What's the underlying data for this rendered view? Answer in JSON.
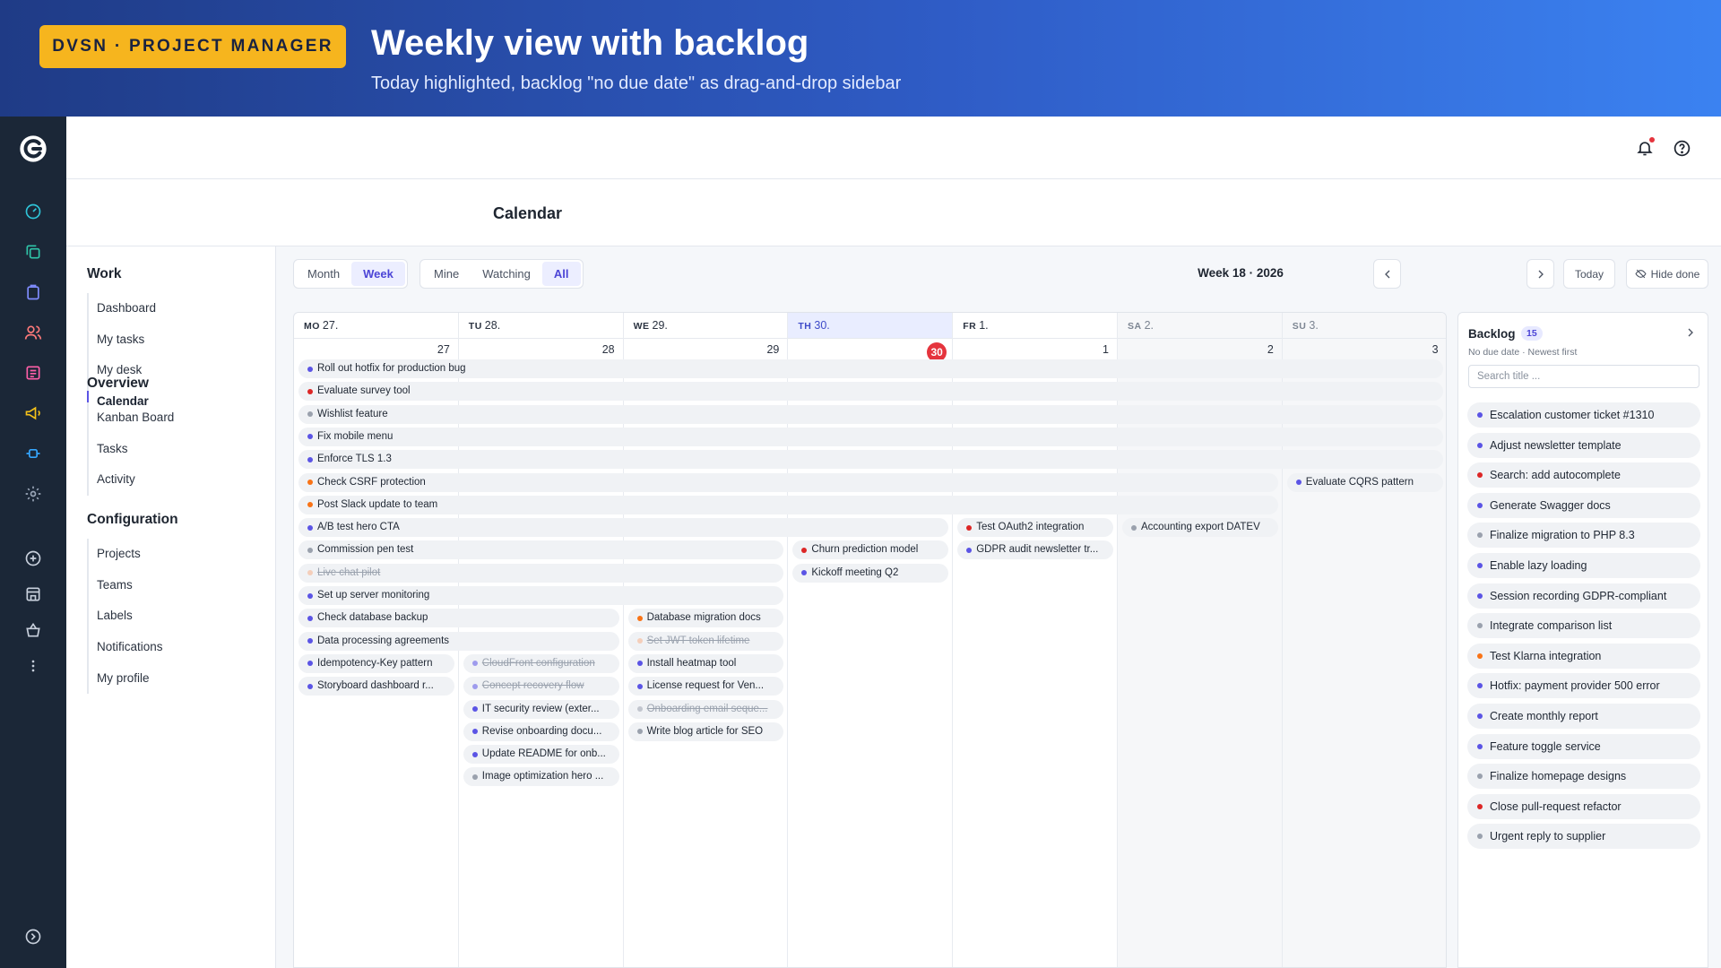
{
  "banner": {
    "badge": "DVSN · PROJECT MANAGER",
    "title": "Weekly view with backlog",
    "subtitle": "Today highlighted, backlog \"no due date\" as drag-and-drop sidebar"
  },
  "header": {
    "title": "Calendar"
  },
  "nav": {
    "sections": [
      {
        "title": "Work",
        "items": [
          "Dashboard",
          "My tasks",
          "My desk",
          "Calendar"
        ]
      },
      {
        "title": "Overview",
        "items": [
          "Kanban Board",
          "Tasks",
          "Activity"
        ]
      },
      {
        "title": "Configuration",
        "items": [
          "Projects",
          "Teams",
          "Labels",
          "Notifications",
          "My profile"
        ]
      }
    ],
    "active": "Calendar"
  },
  "toolbar": {
    "view": [
      "Month",
      "Week"
    ],
    "view_active": "Week",
    "filter": [
      "Mine",
      "Watching",
      "All"
    ],
    "filter_active": "All",
    "week_label": "Week 18 · 2026",
    "today_label": "Today",
    "hide_done_label": "Hide done"
  },
  "colors": {
    "blue": "#5b54e5",
    "red": "#dc2626",
    "gray": "#9aa1ad",
    "orange": "#f97316",
    "peach": "#f7b089",
    "today": "#e5343d",
    "accent": "#4c45d6"
  },
  "calendar": {
    "days": [
      {
        "dow": "MO",
        "label": "27.",
        "num": "27"
      },
      {
        "dow": "TU",
        "label": "28.",
        "num": "28"
      },
      {
        "dow": "WE",
        "label": "29.",
        "num": "29"
      },
      {
        "dow": "TH",
        "label": "30.",
        "num": "30",
        "today": true
      },
      {
        "dow": "FR",
        "label": "1.",
        "num": "1"
      },
      {
        "dow": "SA",
        "label": "2.",
        "num": "2",
        "weekend": true
      },
      {
        "dow": "SU",
        "label": "3.",
        "num": "3",
        "weekend": true
      }
    ],
    "events": [
      {
        "title": "Roll out hotfix for production bug",
        "start": 0,
        "span": 7,
        "row": 0,
        "color": "blue"
      },
      {
        "title": "Evaluate survey tool",
        "start": 0,
        "span": 7,
        "row": 1,
        "color": "red"
      },
      {
        "title": "Wishlist feature",
        "start": 0,
        "span": 7,
        "row": 2,
        "color": "gray"
      },
      {
        "title": "Fix mobile menu",
        "start": 0,
        "span": 7,
        "row": 3,
        "color": "blue"
      },
      {
        "title": "Enforce TLS 1.3",
        "start": 0,
        "span": 7,
        "row": 4,
        "color": "blue"
      },
      {
        "title": "Check CSRF protection",
        "start": 0,
        "span": 6,
        "row": 5,
        "color": "orange"
      },
      {
        "title": "Evaluate CQRS pattern",
        "start": 6,
        "span": 1,
        "row": 5,
        "color": "blue"
      },
      {
        "title": "Post Slack update to team",
        "start": 0,
        "span": 6,
        "row": 6,
        "color": "orange"
      },
      {
        "title": "A/B test hero CTA",
        "start": 0,
        "span": 4,
        "row": 7,
        "color": "blue"
      },
      {
        "title": "Test OAuth2 integration",
        "start": 4,
        "span": 1,
        "row": 7,
        "color": "red"
      },
      {
        "title": "Accounting export DATEV",
        "start": 5,
        "span": 1,
        "row": 7,
        "color": "gray"
      },
      {
        "title": "Commission pen test",
        "start": 0,
        "span": 3,
        "row": 8,
        "color": "gray"
      },
      {
        "title": "Churn prediction model",
        "start": 3,
        "span": 1,
        "row": 8,
        "color": "red"
      },
      {
        "title": "GDPR audit newsletter tr...",
        "start": 4,
        "span": 1,
        "row": 8,
        "color": "blue"
      },
      {
        "title": "Live chat pilot",
        "start": 0,
        "span": 3,
        "row": 9,
        "color": "peach",
        "done": true
      },
      {
        "title": "Kickoff meeting Q2",
        "start": 3,
        "span": 1,
        "row": 9,
        "color": "blue"
      },
      {
        "title": "Set up server monitoring",
        "start": 0,
        "span": 3,
        "row": 10,
        "color": "blue"
      },
      {
        "title": "Check database backup",
        "start": 0,
        "span": 2,
        "row": 11,
        "color": "blue"
      },
      {
        "title": "Database migration docs",
        "start": 2,
        "span": 1,
        "row": 11,
        "color": "orange"
      },
      {
        "title": "Data processing agreements",
        "start": 0,
        "span": 2,
        "row": 12,
        "color": "blue"
      },
      {
        "title": "Set JWT token lifetime",
        "start": 2,
        "span": 1,
        "row": 12,
        "color": "peach",
        "done": true
      },
      {
        "title": "Idempotency-Key pattern",
        "start": 0,
        "span": 1,
        "row": 13,
        "color": "blue"
      },
      {
        "title": "CloudFront configuration",
        "start": 1,
        "span": 1,
        "row": 13,
        "color": "blue",
        "done": true
      },
      {
        "title": "Install heatmap tool",
        "start": 2,
        "span": 1,
        "row": 13,
        "color": "blue"
      },
      {
        "title": "Storyboard dashboard r...",
        "start": 0,
        "span": 1,
        "row": 14,
        "color": "blue"
      },
      {
        "title": "Concept recovery flow",
        "start": 1,
        "span": 1,
        "row": 14,
        "color": "blue",
        "done": true
      },
      {
        "title": "License request for Ven...",
        "start": 2,
        "span": 1,
        "row": 14,
        "color": "blue"
      },
      {
        "title": "IT security review (exter...",
        "start": 1,
        "span": 1,
        "row": 15,
        "color": "blue"
      },
      {
        "title": "Onboarding email seque...",
        "start": 2,
        "span": 1,
        "row": 15,
        "color": "gray",
        "done": true
      },
      {
        "title": "Revise onboarding docu...",
        "start": 1,
        "span": 1,
        "row": 16,
        "color": "blue"
      },
      {
        "title": "Write blog article for SEO",
        "start": 2,
        "span": 1,
        "row": 16,
        "color": "gray"
      },
      {
        "title": "Update README for onb...",
        "start": 1,
        "span": 1,
        "row": 17,
        "color": "blue"
      },
      {
        "title": "Image optimization hero ...",
        "start": 1,
        "span": 1,
        "row": 18,
        "color": "gray"
      }
    ]
  },
  "backlog": {
    "title": "Backlog",
    "count": "15",
    "subtitle": "No due date · Newest first",
    "search_placeholder": "Search title ...",
    "items": [
      {
        "title": "Escalation customer ticket #1310",
        "color": "blue"
      },
      {
        "title": "Adjust newsletter template",
        "color": "blue"
      },
      {
        "title": "Search: add autocomplete",
        "color": "red"
      },
      {
        "title": "Generate Swagger docs",
        "color": "blue"
      },
      {
        "title": "Finalize migration to PHP 8.3",
        "color": "gray"
      },
      {
        "title": "Enable lazy loading",
        "color": "blue"
      },
      {
        "title": "Session recording GDPR-compliant",
        "color": "blue"
      },
      {
        "title": "Integrate comparison list",
        "color": "gray"
      },
      {
        "title": "Test Klarna integration",
        "color": "orange"
      },
      {
        "title": "Hotfix: payment provider 500 error",
        "color": "blue"
      },
      {
        "title": "Create monthly report",
        "color": "blue"
      },
      {
        "title": "Feature toggle service",
        "color": "blue"
      },
      {
        "title": "Finalize homepage designs",
        "color": "gray"
      },
      {
        "title": "Close pull-request refactor",
        "color": "red"
      },
      {
        "title": "Urgent reply to supplier",
        "color": "gray"
      }
    ]
  }
}
